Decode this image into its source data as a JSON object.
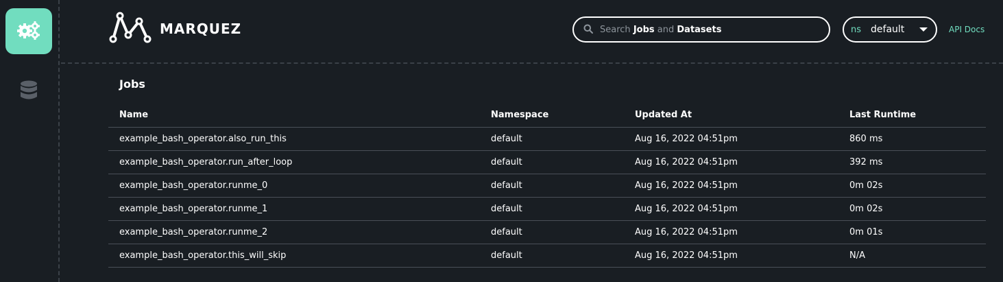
{
  "app": {
    "name": "MARQUEZ"
  },
  "sidebar": {
    "items": [
      {
        "icon": "gears-icon",
        "label": "Jobs",
        "active": true
      },
      {
        "icon": "database-icon",
        "label": "Datasets",
        "active": false
      }
    ]
  },
  "header": {
    "search": {
      "prefix": "Search",
      "jobs": "Jobs",
      "and": "and",
      "datasets": "Datasets"
    },
    "namespace": {
      "prefix": "ns",
      "value": "default"
    },
    "api_docs": "API Docs"
  },
  "main": {
    "title": "Jobs",
    "columns": [
      "Name",
      "Namespace",
      "Updated At",
      "Last Runtime"
    ],
    "rows": [
      {
        "name": "example_bash_operator.also_run_this",
        "namespace": "default",
        "updated_at": "Aug 16, 2022 04:51pm",
        "last_runtime": "860 ms"
      },
      {
        "name": "example_bash_operator.run_after_loop",
        "namespace": "default",
        "updated_at": "Aug 16, 2022 04:51pm",
        "last_runtime": "392 ms"
      },
      {
        "name": "example_bash_operator.runme_0",
        "namespace": "default",
        "updated_at": "Aug 16, 2022 04:51pm",
        "last_runtime": "0m 02s"
      },
      {
        "name": "example_bash_operator.runme_1",
        "namespace": "default",
        "updated_at": "Aug 16, 2022 04:51pm",
        "last_runtime": "0m 02s"
      },
      {
        "name": "example_bash_operator.runme_2",
        "namespace": "default",
        "updated_at": "Aug 16, 2022 04:51pm",
        "last_runtime": "0m 01s"
      },
      {
        "name": "example_bash_operator.this_will_skip",
        "namespace": "default",
        "updated_at": "Aug 16, 2022 04:51pm",
        "last_runtime": "N/A"
      }
    ]
  },
  "colors": {
    "background": "#191e23",
    "accent": "#71ddbf",
    "divider": "#4a5058",
    "muted": "#8d949b"
  }
}
